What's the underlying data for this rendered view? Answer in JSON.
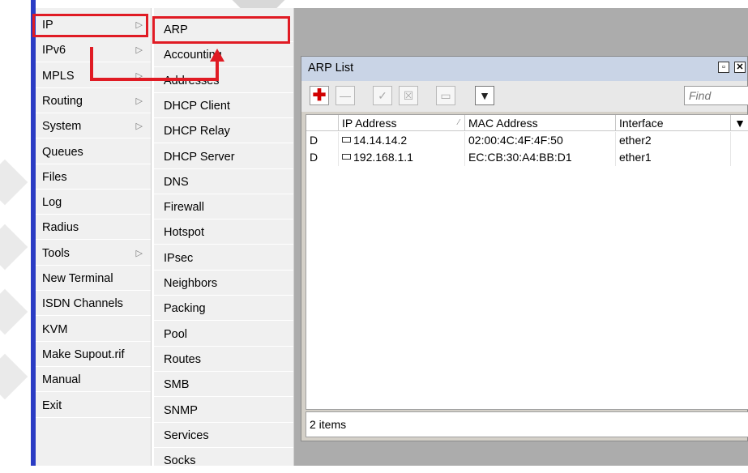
{
  "menu_main": {
    "items": [
      {
        "label": "IP",
        "submenu": true
      },
      {
        "label": "IPv6",
        "submenu": true
      },
      {
        "label": "MPLS",
        "submenu": true
      },
      {
        "label": "Routing",
        "submenu": true
      },
      {
        "label": "System",
        "submenu": true
      },
      {
        "label": "Queues",
        "submenu": false
      },
      {
        "label": "Files",
        "submenu": false
      },
      {
        "label": "Log",
        "submenu": false
      },
      {
        "label": "Radius",
        "submenu": false
      },
      {
        "label": "Tools",
        "submenu": true
      },
      {
        "label": "New Terminal",
        "submenu": false
      },
      {
        "label": "ISDN Channels",
        "submenu": false
      },
      {
        "label": "KVM",
        "submenu": false
      },
      {
        "label": "Make Supout.rif",
        "submenu": false
      },
      {
        "label": "Manual",
        "submenu": false
      },
      {
        "label": "Exit",
        "submenu": false
      }
    ],
    "arrow_glyph": "▷"
  },
  "menu_ip": {
    "items": [
      "ARP",
      "Accounting",
      "Addresses",
      "DHCP Client",
      "DHCP Relay",
      "DHCP Server",
      "DNS",
      "Firewall",
      "Hotspot",
      "IPsec",
      "Neighbors",
      "Packing",
      "Pool",
      "Routes",
      "SMB",
      "SNMP",
      "Services",
      "Socks"
    ]
  },
  "arp_window": {
    "title": "ARP List",
    "find_placeholder": "Find",
    "columns": [
      "",
      "IP Address",
      "MAC Address",
      "Interface"
    ],
    "rows": [
      {
        "flag": "D",
        "ip": "14.14.14.2",
        "mac": "02:00:4C:4F:4F:50",
        "interface": "ether2"
      },
      {
        "flag": "D",
        "ip": "192.168.1.1",
        "mac": "EC:CB:30:A4:BB:D1",
        "interface": "ether1"
      }
    ],
    "status": "2 items"
  },
  "colors": {
    "highlight": "#e01b24",
    "sidebar_bar": "#2a3cc4",
    "title_bar": "#c9d4e6"
  }
}
